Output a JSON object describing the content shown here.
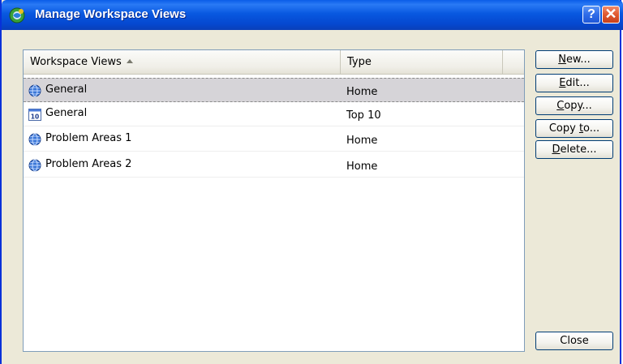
{
  "window": {
    "title": "Manage Workspace Views",
    "help_label": "?",
    "close_label": "✕"
  },
  "list": {
    "columns": [
      {
        "label": "Workspace Views",
        "sorted": "ascending"
      },
      {
        "label": "Type"
      },
      {
        "label": ""
      }
    ],
    "rows": [
      {
        "name": "General",
        "type": "Home",
        "icon": "globe-icon",
        "selected": true
      },
      {
        "name": "General",
        "type": "Top 10",
        "icon": "top10-calendar-icon",
        "selected": false
      },
      {
        "name": "Problem Areas 1",
        "type": "Home",
        "icon": "globe-icon",
        "selected": false
      },
      {
        "name": "Problem Areas 2",
        "type": "Home",
        "icon": "globe-icon",
        "selected": false
      }
    ]
  },
  "buttons": {
    "new": {
      "label": "New...",
      "accel": "N"
    },
    "edit": {
      "label": "Edit...",
      "accel": "E"
    },
    "copy": {
      "label": "Copy...",
      "accel": "C"
    },
    "copyto": {
      "label": "Copy to...",
      "accel": "t"
    },
    "delete": {
      "label": "Delete...",
      "accel": "D"
    },
    "close": {
      "label": "Close"
    }
  },
  "top10_icon_text": "10",
  "colors": {
    "titlebar": "#0858e0",
    "dialog_bg": "#ece9d8",
    "selection": "#d6d4d8",
    "button_border": "#003c74"
  }
}
